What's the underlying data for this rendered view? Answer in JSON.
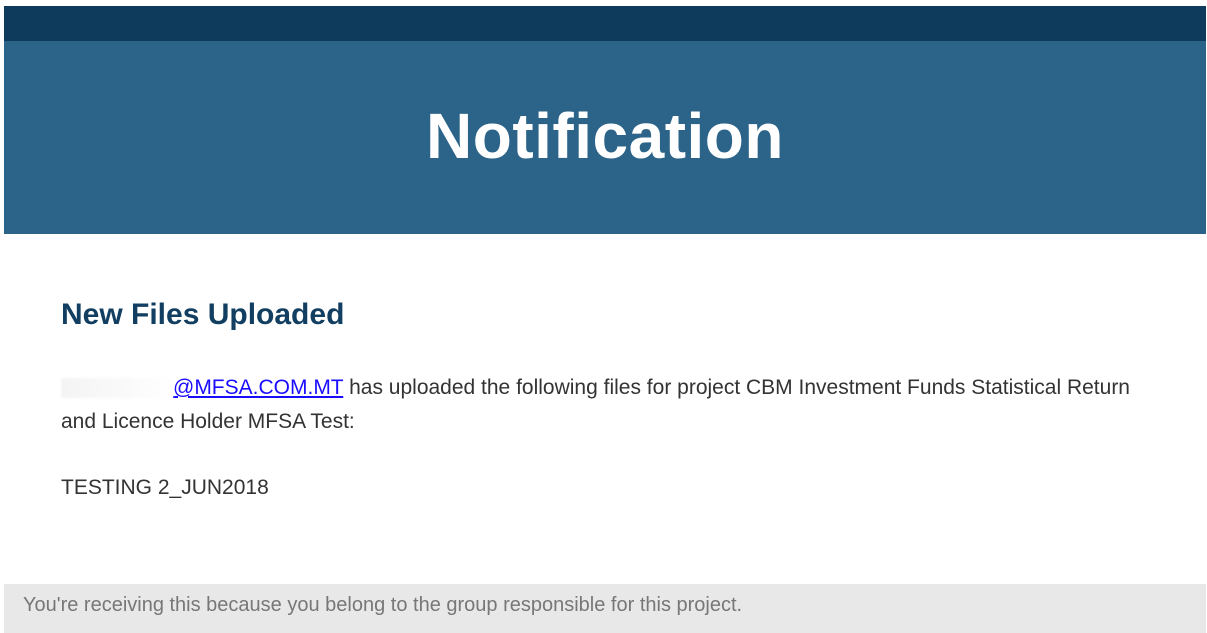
{
  "banner": {
    "title": "Notification"
  },
  "content": {
    "heading": "New Files Uploaded",
    "sender_email_link": "@MFSA.COM.MT",
    "message_text": " has uploaded the following files for project CBM Investment Funds Statistical Return and Licence Holder MFSA Test:",
    "files": [
      "TESTING 2_JUN2018"
    ]
  },
  "footer": {
    "text": "You're receiving this because you belong to the group responsible for this project."
  },
  "colors": {
    "top_strip": "#0e3a5b",
    "banner_background": "#2b6389",
    "heading_color": "#123f61",
    "link_color": "#1a0dff",
    "footer_background": "#e8e8e8"
  }
}
